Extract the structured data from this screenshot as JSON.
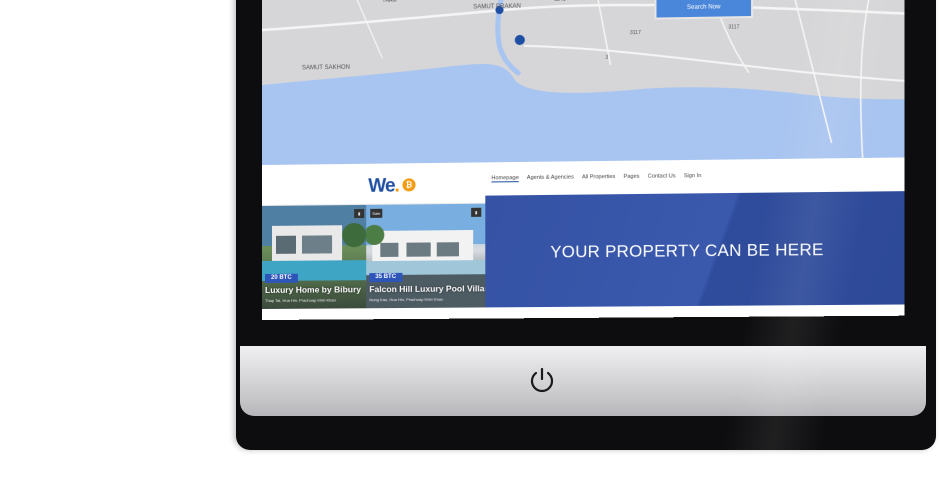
{
  "map": {
    "search_button": "Search Now",
    "place_labels": [
      "SAMUT PRAKAN",
      "SAMUT SAKHON",
      "THAM"
    ],
    "road_labels": [
      "3241",
      "3117",
      "3117",
      "3"
    ],
    "colors": {
      "land": "#d6d6d8",
      "water": "#a8c4f0",
      "road": "#f5f5f5",
      "pin": "#1f4fa3"
    }
  },
  "nav": {
    "logo": "We",
    "logo_dot": ".",
    "btc_symbol": "₿",
    "items": [
      "Homepage",
      "Agents & Agencies",
      "All Properties",
      "Pages",
      "Contact Us",
      "Sign In"
    ]
  },
  "cards": [
    {
      "price": "20 BTC",
      "title": "Luxury Home by Bibury",
      "address": "Thap Tai, Hua Hin, Prachuap Khiri Khan",
      "tag": ""
    },
    {
      "price": "35 BTC",
      "title": "Falcon Hill Luxury Pool Villas",
      "address": "Nong Kae, Hua Hin, Prachuap Khiri Khan",
      "tag": "Sale"
    }
  ],
  "promo": {
    "text": "YOUR PROPERTY CAN BE HERE"
  },
  "colors": {
    "accent": "#2e55b8",
    "promo_bg": "#3552a4",
    "bitcoin": "#f39c12"
  }
}
